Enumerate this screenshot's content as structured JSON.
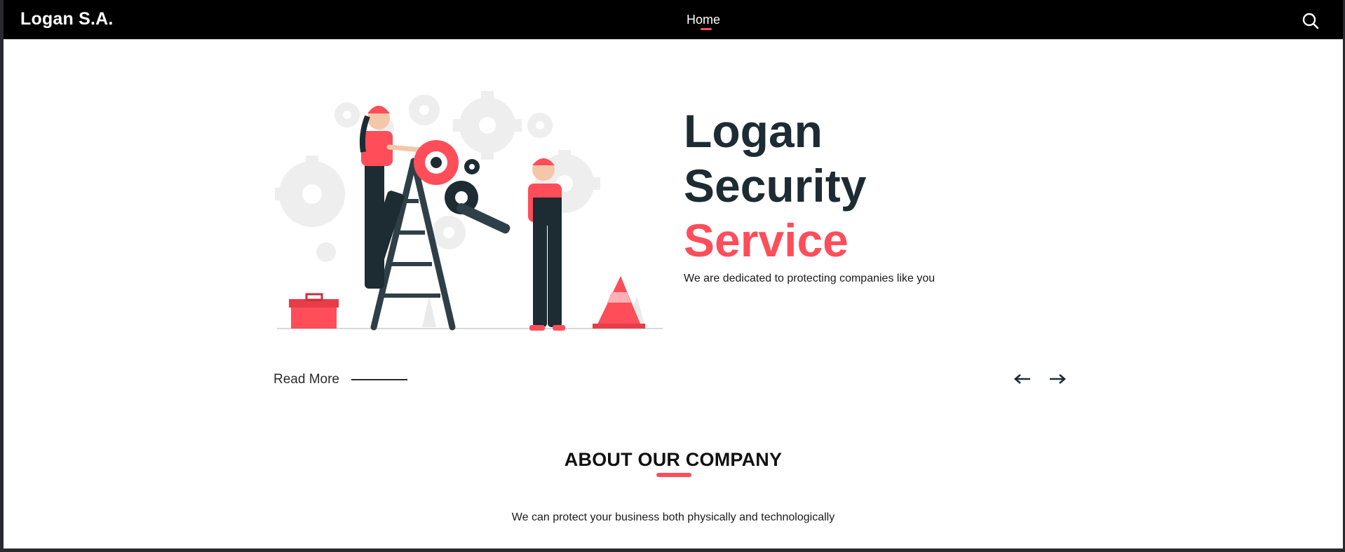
{
  "navbar": {
    "brand": "Logan S.A.",
    "links": [
      {
        "label": "Home",
        "active": true
      }
    ],
    "search_icon": "search-icon",
    "accent_color": "#ff4d5a"
  },
  "hero": {
    "title_line1": "Logan",
    "title_line2": "Security",
    "title_line3": "Service",
    "subtitle": "We are dedicated to protecting companies like you",
    "read_more": "Read More",
    "prev_icon": "arrow-left-icon",
    "next_icon": "arrow-right-icon",
    "title_color": "#1d2b33",
    "accent_color": "#ff4d5a"
  },
  "about": {
    "title": "ABOUT OUR COMPANY",
    "description": "We can protect your business both physically and technologically"
  }
}
